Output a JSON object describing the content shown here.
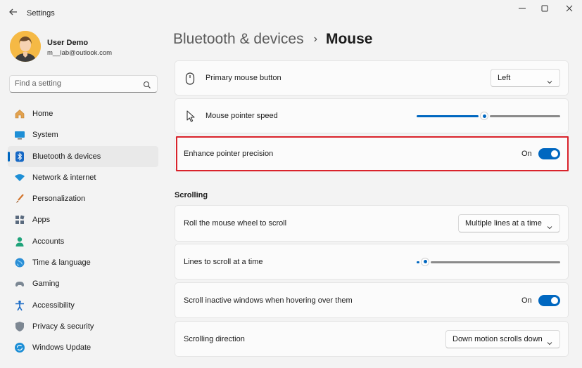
{
  "window": {
    "title": "Settings",
    "back_icon": "back-arrow-icon",
    "controls": {
      "minimize": "minimize-icon",
      "maximize": "maximize-icon",
      "close": "close-icon"
    }
  },
  "user": {
    "name": "User Demo",
    "email": "m__lab@outlook.com"
  },
  "search": {
    "placeholder": "Find a setting"
  },
  "sidebar": {
    "active_index": 2,
    "items": [
      {
        "label": "Home",
        "icon": "home-icon"
      },
      {
        "label": "System",
        "icon": "system-icon"
      },
      {
        "label": "Bluetooth & devices",
        "icon": "bluetooth-icon"
      },
      {
        "label": "Network & internet",
        "icon": "wifi-icon"
      },
      {
        "label": "Personalization",
        "icon": "brush-icon"
      },
      {
        "label": "Apps",
        "icon": "apps-icon"
      },
      {
        "label": "Accounts",
        "icon": "accounts-icon"
      },
      {
        "label": "Time & language",
        "icon": "globe-icon"
      },
      {
        "label": "Gaming",
        "icon": "gamepad-icon"
      },
      {
        "label": "Accessibility",
        "icon": "accessibility-icon"
      },
      {
        "label": "Privacy & security",
        "icon": "shield-icon"
      },
      {
        "label": "Windows Update",
        "icon": "update-icon"
      }
    ]
  },
  "breadcrumb": {
    "parent": "Bluetooth & devices",
    "separator": "›",
    "current": "Mouse"
  },
  "settings": {
    "primary_button": {
      "label": "Primary mouse button",
      "value": "Left",
      "icon": "mouse-icon"
    },
    "pointer_speed": {
      "label": "Mouse pointer speed",
      "level": 0.47,
      "icon": "pointer-icon"
    },
    "enhance_precision": {
      "label": "Enhance pointer precision",
      "state": "On",
      "enabled": true
    }
  },
  "scrolling": {
    "title": "Scrolling",
    "roll_wheel": {
      "label": "Roll the mouse wheel to scroll",
      "value": "Multiple lines at a time"
    },
    "lines": {
      "label": "Lines to scroll at a time",
      "level": 0.03
    },
    "inactive": {
      "label": "Scroll inactive windows when hovering over them",
      "state": "On",
      "enabled": true
    },
    "direction": {
      "label": "Scrolling direction",
      "value": "Down motion scrolls down"
    }
  },
  "colors": {
    "accent": "#0067c0",
    "highlight_border": "#d9232b"
  }
}
